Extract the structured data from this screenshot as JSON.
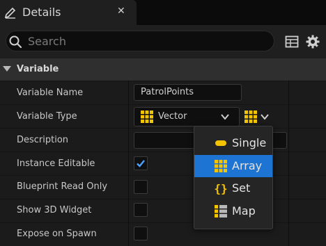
{
  "tab": {
    "title": "Details",
    "close": "✕"
  },
  "search": {
    "placeholder": "Search",
    "value": ""
  },
  "category": {
    "title": "Variable"
  },
  "rows": [
    {
      "label": "Variable Name"
    },
    {
      "label": "Variable Type"
    },
    {
      "label": "Description"
    },
    {
      "label": "Instance Editable"
    },
    {
      "label": "Blueprint Read Only"
    },
    {
      "label": "Show 3D Widget"
    },
    {
      "label": "Expose on Spawn"
    }
  ],
  "fields": {
    "variable_name": "PatrolPoints",
    "variable_type": "Vector",
    "description": "",
    "instance_editable": true,
    "blueprint_read_only": false,
    "show_3d_widget": false,
    "expose_on_spawn": false
  },
  "container_menu": {
    "items": [
      {
        "label": "Single",
        "icon": "single-pill-icon"
      },
      {
        "label": "Array",
        "icon": "array-grid-icon",
        "selected": true
      },
      {
        "label": "Set",
        "icon": "set-braces-icon"
      },
      {
        "label": "Map",
        "icon": "map-list-icon"
      }
    ]
  },
  "colors": {
    "accent_yellow": "#f5c400",
    "selection_blue": "#1e74d2",
    "panel_bg": "#1b1b1b",
    "header_bg": "#2f2f2f"
  },
  "icons": [
    "pencil-icon",
    "close-icon",
    "search-icon",
    "table-icon",
    "gear-icon",
    "collapse-arrow-icon",
    "chevron-down-icon",
    "checkmark-icon"
  ]
}
